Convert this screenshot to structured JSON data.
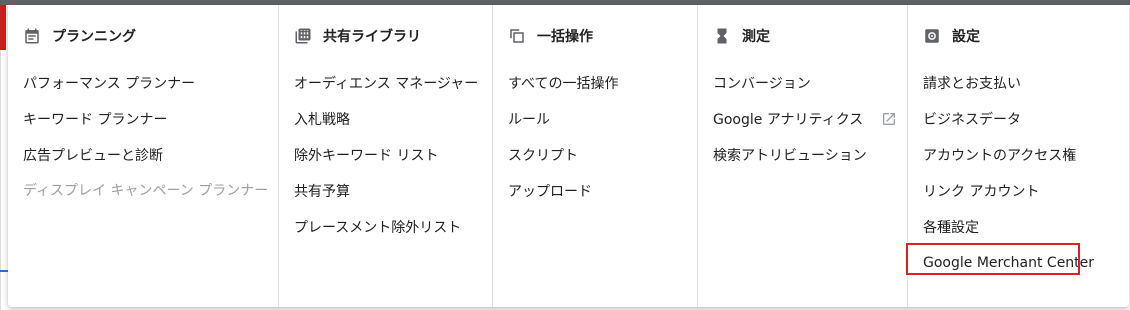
{
  "colors": {
    "highlight": "#e02020",
    "text": "#202124",
    "disabled": "#9aa0a6",
    "icon": "#5f6368"
  },
  "columns": [
    {
      "title": "プランニング",
      "icon": "calendar-icon",
      "items": [
        {
          "label": "パフォーマンス プランナー"
        },
        {
          "label": "キーワード プランナー"
        },
        {
          "label": "広告プレビューと診断"
        },
        {
          "label": "ディスプレイ キャンペーン プランナー",
          "disabled": true
        }
      ]
    },
    {
      "title": "共有ライブラリ",
      "icon": "library-grid-icon",
      "items": [
        {
          "label": "オーディエンス マネージャー"
        },
        {
          "label": "入札戦略"
        },
        {
          "label": "除外キーワード リスト"
        },
        {
          "label": "共有予算"
        },
        {
          "label": "プレースメント除外リスト"
        }
      ]
    },
    {
      "title": "一括操作",
      "icon": "copy-stack-icon",
      "items": [
        {
          "label": "すべての一括操作"
        },
        {
          "label": "ルール"
        },
        {
          "label": "スクリプト"
        },
        {
          "label": "アップロード"
        }
      ]
    },
    {
      "title": "測定",
      "icon": "hourglass-icon",
      "items": [
        {
          "label": "コンバージョン"
        },
        {
          "label": "Google アナリティクス",
          "external": true
        },
        {
          "label": "検索アトリビューション"
        }
      ]
    },
    {
      "title": "設定",
      "icon": "gear-icon",
      "items": [
        {
          "label": "請求とお支払い"
        },
        {
          "label": "ビジネスデータ"
        },
        {
          "label": "アカウントのアクセス権"
        },
        {
          "label": "リンク アカウント"
        },
        {
          "label": "各種設定"
        },
        {
          "label": "Google Merchant Center",
          "highlighted": true
        }
      ]
    }
  ]
}
